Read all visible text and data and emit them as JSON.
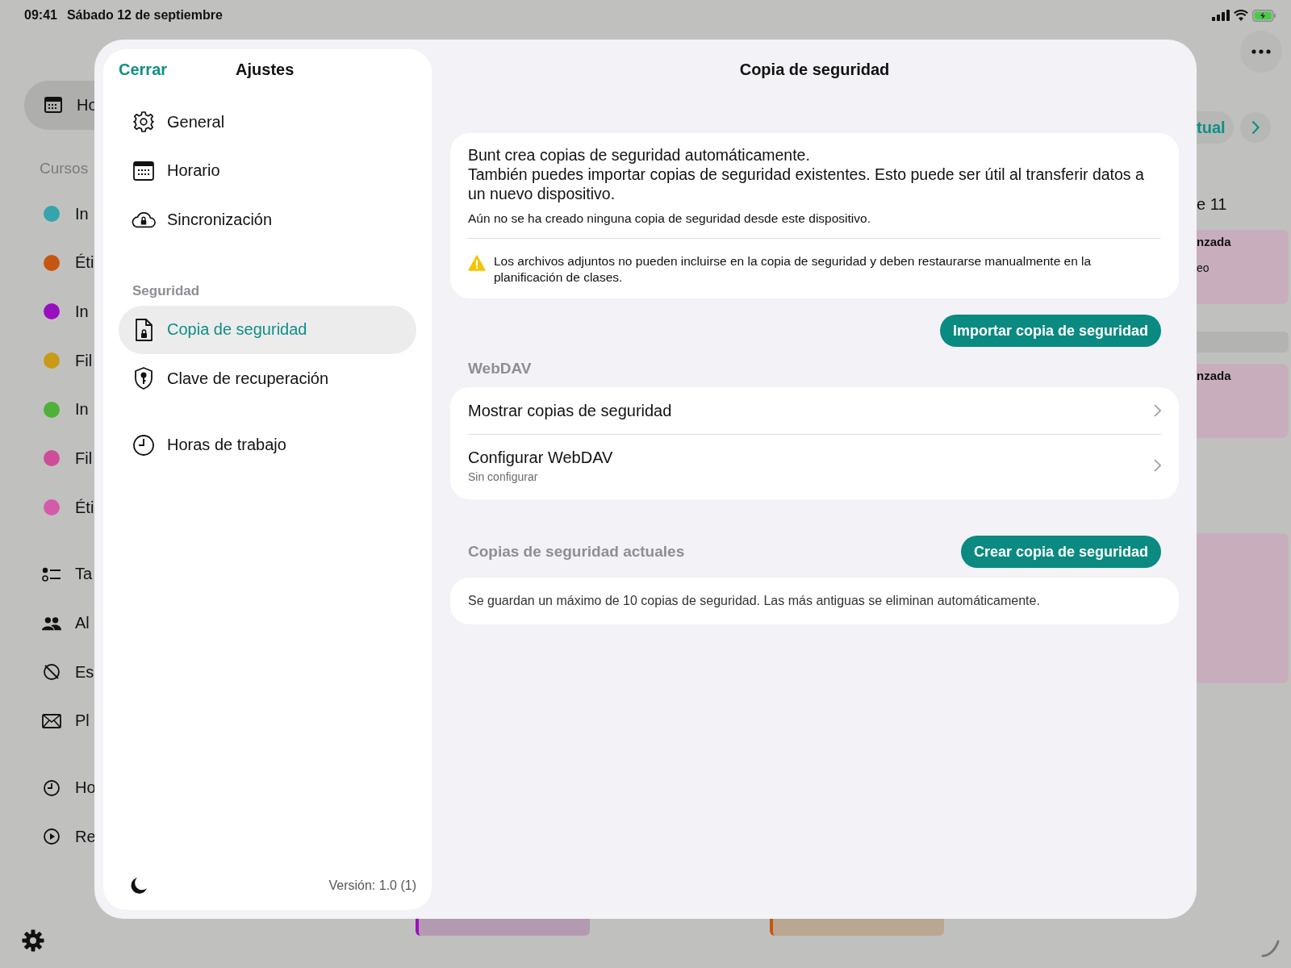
{
  "status_bar": {
    "time": "09:41",
    "date": "Sábado 12 de septiembre"
  },
  "background": {
    "sidebar": {
      "top_items": [
        {
          "label": "Ho",
          "selected": true
        }
      ],
      "section": "Cursos",
      "courses": [
        {
          "label": "In",
          "color": "#35a4ad",
          "selected": false
        },
        {
          "label": "Éti",
          "color": "#c4560f",
          "selected": false
        },
        {
          "label": "In",
          "color": "#9a0fbd",
          "selected": false
        },
        {
          "label": "Fil",
          "color": "#c99a17",
          "selected": false
        },
        {
          "label": "In",
          "color": "#4fb03a",
          "selected": false
        },
        {
          "label": "Fil",
          "color": "#cf4d97",
          "selected": false
        },
        {
          "label": "Éti",
          "color": "#d45ba7",
          "selected": false
        }
      ],
      "tools": [
        {
          "label": "Ta",
          "selected": false
        },
        {
          "label": "Al",
          "selected": false
        },
        {
          "label": "Es",
          "selected": false
        },
        {
          "label": "Pl",
          "selected": false
        }
      ],
      "more": [
        {
          "label": "Ho",
          "selected": false
        },
        {
          "label": "Re",
          "selected": false
        }
      ]
    },
    "right": {
      "pill": "tual",
      "date": "e 11",
      "cards": [
        {
          "title": "nzada",
          "subtitle": "eo"
        },
        {
          "title": "nzada"
        }
      ]
    }
  },
  "settings": {
    "close": "Cerrar",
    "title": "Ajustes",
    "groups": [
      {
        "items": [
          {
            "label": "General",
            "selected": false
          },
          {
            "label": "Horario",
            "selected": false
          },
          {
            "label": "Sincronización",
            "selected": false
          }
        ]
      },
      {
        "header": "Seguridad",
        "items": [
          {
            "label": "Copia de seguridad",
            "selected": true
          },
          {
            "label": "Clave de recuperación",
            "selected": false
          }
        ]
      },
      {
        "items": [
          {
            "label": "Horas de trabajo",
            "selected": false
          }
        ]
      }
    ],
    "version": "Versión: 1.0 (1)"
  },
  "detail": {
    "title": "Copia de seguridad",
    "intro": [
      "Bunt crea copias de seguridad automáticamente.",
      "También puedes importar copias de seguridad existentes. Esto puede ser útil al transferir datos a un nuevo dispositivo."
    ],
    "status": "Aún no se ha creado ninguna copia de seguridad desde este dispositivo.",
    "warning": "Los archivos adjuntos no pueden incluirse en la copia de seguridad y deben restaurarse manualmente en la planificación de clases.",
    "import_button": "Importar copia de seguridad",
    "webdav": {
      "header": "WebDAV",
      "rows": [
        {
          "title": "Mostrar copias de seguridad"
        },
        {
          "title": "Configurar WebDAV",
          "subtitle": "Sin configurar"
        }
      ]
    },
    "current": {
      "header": "Copias de seguridad actuales",
      "button": "Crear copia de seguridad",
      "note": "Se guardan un máximo de 10 copias de seguridad. Las más antiguas se eliminan automáticamente."
    }
  }
}
